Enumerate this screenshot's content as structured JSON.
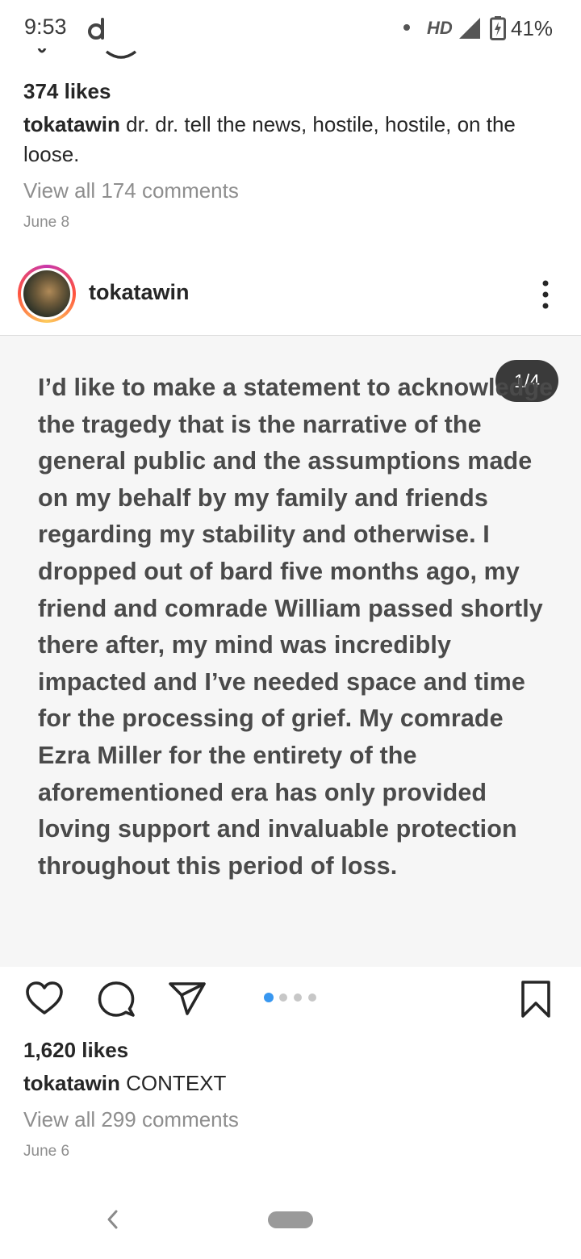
{
  "status_bar": {
    "time": "9:53",
    "network": "HD",
    "battery": "41%",
    "app_icon": "d-app-icon"
  },
  "previous_post": {
    "likes": "374 likes",
    "username": "tokatawin",
    "caption": "dr. dr. tell the news, hostile, hostile, on the loose.",
    "view_comments": "View all 174 comments",
    "date": "June 8"
  },
  "post": {
    "username": "tokatawin",
    "carousel_counter": "1/4",
    "statement": "I’d like to make a statement to acknowledge the tragedy that is the narrative of the general public and the assumptions made on my behalf by my family and friends regarding my stability and otherwise. I dropped out of bard five months ago, my friend and comrade William passed shortly there after, my mind was incredibly impacted and I’ve needed space and time for the processing of grief. My comrade Ezra Miller for the entirety of the aforementioned era has only provided loving support and invaluable protection throughout this period of loss.",
    "carousel_slides": 4,
    "carousel_active": 1,
    "likes": "1,620 likes",
    "caption_username": "tokatawin",
    "caption": "CONTEXT",
    "view_comments": "View all 299 comments",
    "date": "June 6"
  },
  "icons": {
    "like": "heart-icon",
    "comment": "comment-icon",
    "share": "send-icon",
    "save": "bookmark-icon",
    "more": "more-vertical-icon"
  },
  "colors": {
    "active_dot": "#3897f0",
    "muted_text": "#8e8e8e",
    "counter_bg": "#3a3a3a"
  }
}
